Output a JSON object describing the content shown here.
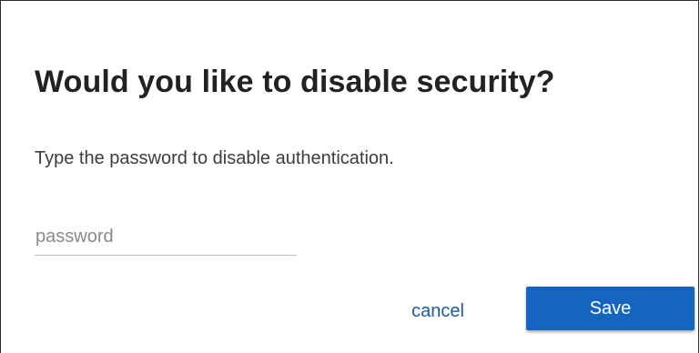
{
  "dialog": {
    "title": "Would you like to disable security?",
    "description": "Type the password to disable authentication.",
    "password": {
      "value": "",
      "placeholder": "password"
    },
    "cancel_label": "cancel",
    "save_label": "Save"
  },
  "colors": {
    "primary": "#1565c0",
    "link": "#1a5aa6",
    "title_text": "#222222",
    "body_text": "#3c3c3c"
  }
}
